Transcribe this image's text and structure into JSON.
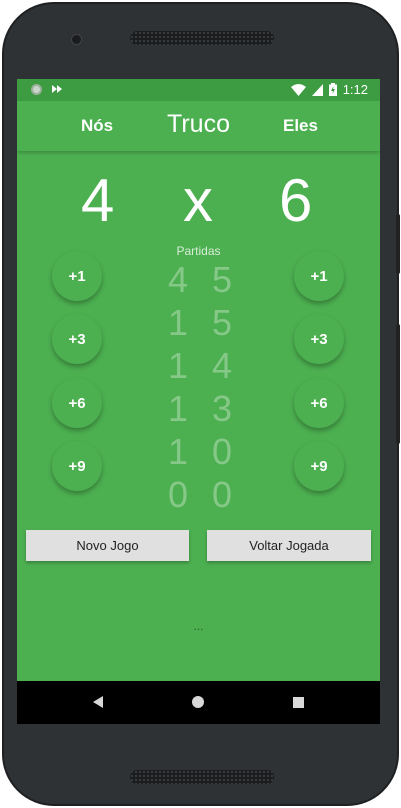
{
  "statusbar": {
    "time": "1:12",
    "battery_icon": "battery-charging-icon",
    "wifi_icon": "wifi-icon",
    "signal_icon": "signal-icon"
  },
  "appbar": {
    "left_label": "Nós",
    "title": "Truco",
    "right_label": "Eles"
  },
  "score": {
    "nos": "4",
    "separator": "x",
    "eles": "6"
  },
  "history": {
    "label": "Partidas",
    "rows": [
      [
        "4",
        "5"
      ],
      [
        "1",
        "5"
      ],
      [
        "1",
        "4"
      ],
      [
        "1",
        "3"
      ],
      [
        "1",
        "0"
      ],
      [
        "0",
        "0"
      ]
    ]
  },
  "left_buttons": [
    "+1",
    "+3",
    "+6",
    "+9"
  ],
  "right_buttons": [
    "+1",
    "+3",
    "+6",
    "+9"
  ],
  "actions": {
    "new_game": "Novo Jogo",
    "undo": "Voltar Jogada"
  },
  "footer_text": "...",
  "colors": {
    "primary": "#4caf50",
    "status_bar": "#3d9c41",
    "button_bg": "#e0e0e0"
  }
}
